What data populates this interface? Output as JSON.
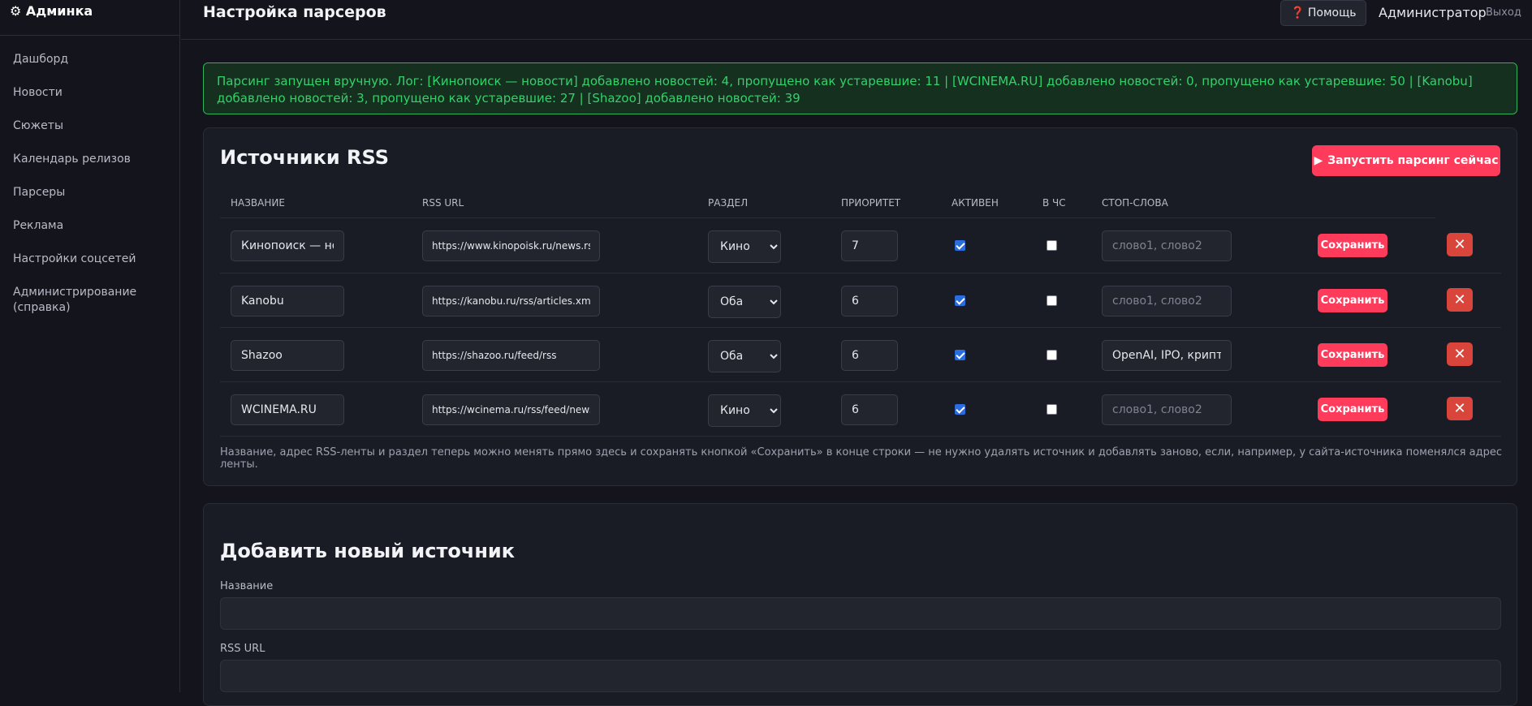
{
  "brand": "⚙ Админка",
  "nav": [
    "Дашборд",
    "Новости",
    "Сюжеты",
    "Календарь релизов",
    "Парсеры",
    "Реклама",
    "Настройки соцсетей",
    "Администрирование (справка)"
  ],
  "topbar": {
    "title": "Настройка парсеров",
    "help_icon": "❓",
    "help_label": "Помощь",
    "admin_name": "Администратор",
    "logout": "Выход"
  },
  "alert": "Парсинг запущен вручную. Лог: [Кинопоиск — новости] добавлено новостей: 4, пропущено как устаревшие: 11 | [WCINEMA.RU] добавлено новостей: 0, пропущено как устаревшие: 50 | [Kanobu] добавлено новостей: 3, пропущено как устаревшие: 27 | [Shazoo] добавлено новостей: 39",
  "sources": {
    "title": "Источники RSS",
    "run_icon": "▶",
    "run_label": "Запустить парсинг сейчас",
    "headers": {
      "name": "Название",
      "url": "RSS URL",
      "section": "Раздел",
      "priority": "Приоритет",
      "active": "Активен",
      "emergency": "В ЧС",
      "stopwords": "Стоп-слова"
    },
    "stopwords_placeholder": "слово1, слово2",
    "save_label": "Сохранить",
    "delete_icon": "✕",
    "rows": [
      {
        "name": "Кинопоиск — новости",
        "url": "https://www.kinopoisk.ru/news.rss",
        "section": "Кино",
        "priority": "7",
        "active": true,
        "emergency": false,
        "stopwords": ""
      },
      {
        "name": "Kanobu",
        "url": "https://kanobu.ru/rss/articles.xml",
        "section": "Оба",
        "priority": "6",
        "active": true,
        "emergency": false,
        "stopwords": ""
      },
      {
        "name": "Shazoo",
        "url": "https://shazoo.ru/feed/rss",
        "section": "Оба",
        "priority": "6",
        "active": true,
        "emergency": false,
        "stopwords": "OpenAI, IPO, криптовалюта"
      },
      {
        "name": "WCINEMA.RU",
        "url": "https://wcinema.ru/rss/feed/news",
        "section": "Кино",
        "priority": "6",
        "active": true,
        "emergency": false,
        "stopwords": ""
      }
    ],
    "note": "Название, адрес RSS-ленты и раздел теперь можно менять прямо здесь и сохранять кнопкой «Сохранить» в конце строки — не нужно удалять источник и добавлять заново, если, например, у сайта-источника поменялся адрес ленты."
  },
  "add_form": {
    "title": "Добавить новый источник",
    "name_label": "Название",
    "url_label": "RSS URL"
  }
}
